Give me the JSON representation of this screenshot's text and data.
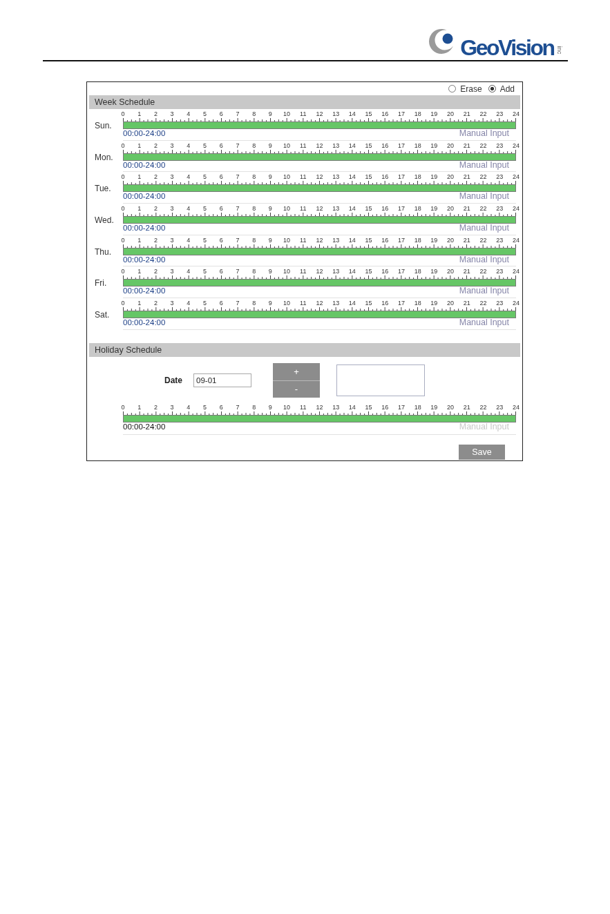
{
  "header": {
    "logo": {
      "name": "GeoVision",
      "suffix": "inc"
    }
  },
  "mode_options": [
    {
      "label": "Erase",
      "selected": false
    },
    {
      "label": "Add",
      "selected": true
    }
  ],
  "week_schedule": {
    "title": "Week Schedule",
    "days": [
      {
        "day": "Sun.",
        "hours": [
          "0",
          "1",
          "2",
          "3",
          "4",
          "5",
          "6",
          "7",
          "8",
          "9",
          "10",
          "11",
          "12",
          "13",
          "14",
          "15",
          "16",
          "17",
          "18",
          "19",
          "20",
          "21",
          "22",
          "23",
          "24"
        ],
        "level": 1,
        "range": "00:00-24:00",
        "manual_input": {
          "label": "Manual Input",
          "disabled": false
        }
      },
      {
        "day": "Mon.",
        "hours": [
          "0",
          "1",
          "2",
          "3",
          "4",
          "5",
          "6",
          "7",
          "8",
          "9",
          "10",
          "11",
          "12",
          "13",
          "14",
          "15",
          "16",
          "17",
          "18",
          "19",
          "20",
          "21",
          "22",
          "23",
          "24"
        ],
        "level": 1,
        "range": "00:00-24:00",
        "manual_input": {
          "label": "Manual Input",
          "disabled": false
        }
      },
      {
        "day": "Tue.",
        "hours": [
          "0",
          "1",
          "2",
          "3",
          "4",
          "5",
          "6",
          "7",
          "8",
          "9",
          "10",
          "11",
          "12",
          "13",
          "14",
          "15",
          "16",
          "17",
          "18",
          "19",
          "20",
          "21",
          "22",
          "23",
          "24"
        ],
        "level": 1,
        "range": "00:00-24:00",
        "manual_input": {
          "label": "Manual Input",
          "disabled": false
        }
      },
      {
        "day": "Wed.",
        "hours": [
          "0",
          "1",
          "2",
          "3",
          "4",
          "5",
          "6",
          "7",
          "8",
          "9",
          "10",
          "11",
          "12",
          "13",
          "14",
          "15",
          "16",
          "17",
          "18",
          "19",
          "20",
          "21",
          "22",
          "23",
          "24"
        ],
        "level": 1,
        "range": "00:00-24:00",
        "manual_input": {
          "label": "Manual Input",
          "disabled": false
        }
      },
      {
        "day": "Thu.",
        "hours": [
          "0",
          "1",
          "2",
          "3",
          "4",
          "5",
          "6",
          "7",
          "8",
          "9",
          "10",
          "11",
          "12",
          "13",
          "14",
          "15",
          "16",
          "17",
          "18",
          "19",
          "20",
          "21",
          "22",
          "23",
          "24"
        ],
        "level": 1,
        "range": "00:00-24:00",
        "manual_input": {
          "label": "Manual Input",
          "disabled": false
        }
      },
      {
        "day": "Fri.",
        "hours": [
          "0",
          "1",
          "2",
          "3",
          "4",
          "5",
          "6",
          "7",
          "8",
          "9",
          "10",
          "11",
          "12",
          "13",
          "14",
          "15",
          "16",
          "17",
          "18",
          "19",
          "20",
          "21",
          "22",
          "23",
          "24"
        ],
        "level": 1,
        "range": "00:00-24:00",
        "manual_input": {
          "label": "Manual Input",
          "disabled": false
        }
      },
      {
        "day": "Sat.",
        "hours": [
          "0",
          "1",
          "2",
          "3",
          "4",
          "5",
          "6",
          "7",
          "8",
          "9",
          "10",
          "11",
          "12",
          "13",
          "14",
          "15",
          "16",
          "17",
          "18",
          "19",
          "20",
          "21",
          "22",
          "23",
          "24"
        ],
        "level": 1,
        "range": "00:00-24:00",
        "manual_input": {
          "label": "Manual Input",
          "disabled": false
        }
      }
    ]
  },
  "holiday_schedule": {
    "title": "Holiday Schedule",
    "date_label": "Date",
    "date": "09-01",
    "add_button": "+",
    "remove_button": "-",
    "timeline": {
      "hours": [
        "0",
        "1",
        "2",
        "3",
        "4",
        "5",
        "6",
        "7",
        "8",
        "9",
        "10",
        "11",
        "12",
        "13",
        "14",
        "15",
        "16",
        "17",
        "18",
        "19",
        "20",
        "21",
        "22",
        "23",
        "24"
      ],
      "level": 1,
      "range": "00:00-24:00",
      "manual_input": {
        "label": "Manual Input",
        "disabled": true
      }
    }
  },
  "save_button": "Save"
}
